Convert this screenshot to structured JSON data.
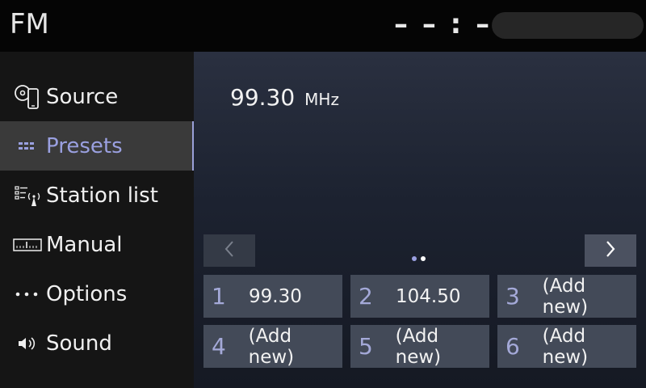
{
  "header": {
    "title": "FM",
    "clock": "– – : – –"
  },
  "sidebar": {
    "items": [
      {
        "label": "Source",
        "icon": "source-icon"
      },
      {
        "label": "Presets",
        "icon": "presets-icon",
        "active": true
      },
      {
        "label": "Station list",
        "icon": "station-list-icon"
      },
      {
        "label": "Manual",
        "icon": "manual-tuning-icon"
      },
      {
        "label": "Options",
        "icon": "more-dots-icon"
      },
      {
        "label": "Sound",
        "icon": "speaker-icon"
      }
    ]
  },
  "main": {
    "frequency": "99.30",
    "unit": "MHz",
    "pager": {
      "prev_icon": "chevron-left-icon",
      "next_icon": "chevron-right-icon",
      "pages": 2,
      "current": 1
    },
    "presets": [
      {
        "num": "1",
        "value": "99.30"
      },
      {
        "num": "2",
        "value": "104.50"
      },
      {
        "num": "3",
        "value": "(Add new)"
      },
      {
        "num": "4",
        "value": "(Add new)"
      },
      {
        "num": "5",
        "value": "(Add new)"
      },
      {
        "num": "6",
        "value": "(Add new)"
      }
    ]
  },
  "colors": {
    "accent": "#9aa0e0",
    "preset_bg": "#434a58",
    "dot_active": "#ffffff",
    "dot_inactive": "#9aa0e0"
  }
}
